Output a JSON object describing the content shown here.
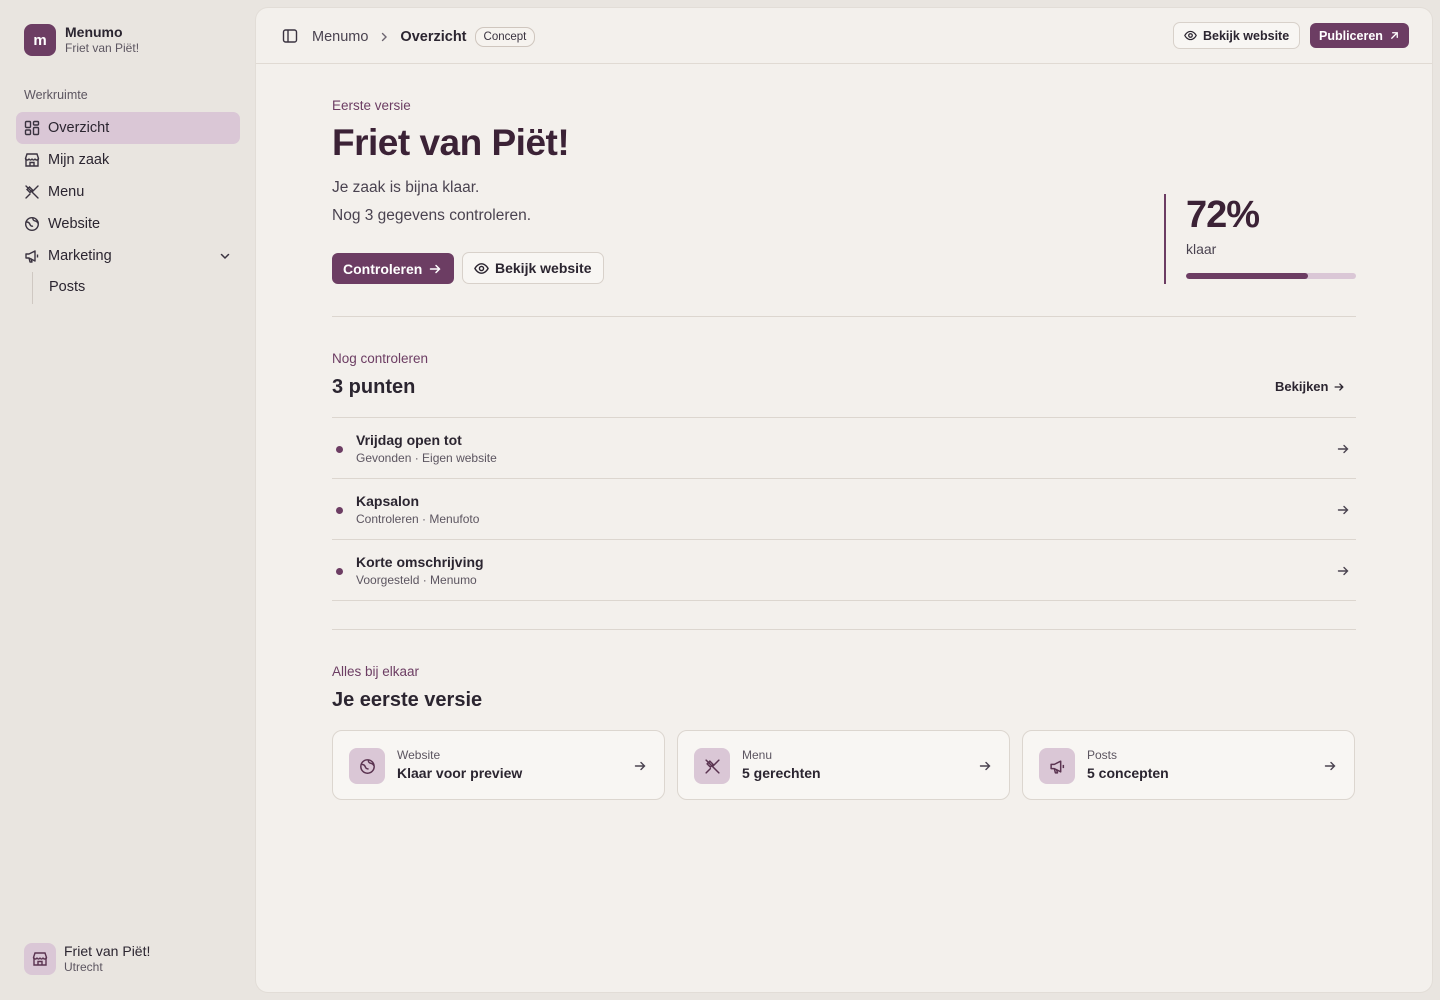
{
  "app": {
    "name": "Menumo",
    "business": "Friet van Piët!",
    "logo_letter": "m"
  },
  "sidebar": {
    "section_label": "Werkruimte",
    "items": [
      {
        "label": "Overzicht",
        "icon": "dashboard-icon",
        "active": true
      },
      {
        "label": "Mijn zaak",
        "icon": "store-icon"
      },
      {
        "label": "Menu",
        "icon": "utensils-icon"
      },
      {
        "label": "Website",
        "icon": "globe-icon"
      },
      {
        "label": "Marketing",
        "icon": "megaphone-icon",
        "expanded": true
      }
    ],
    "sub_items": [
      {
        "label": "Posts"
      }
    ],
    "account": {
      "name": "Friet van Piët!",
      "city": "Utrecht",
      "icon": "store-icon"
    }
  },
  "topbar": {
    "breadcrumb_root": "Menumo",
    "breadcrumb_current": "Overzicht",
    "status_badge": "Concept",
    "view_label": "Bekijk website",
    "publish_label": "Publiceren"
  },
  "hero": {
    "eyebrow": "Eerste versie",
    "title": "Friet van Piët!",
    "line1": "Je zaak is bijna klaar.",
    "line2": "Nog 3 gegevens controleren.",
    "primary_cta": "Controleren",
    "secondary_cta": "Bekijk website",
    "progress_text": "72%",
    "progress_label": "klaar",
    "progress_value": 0.72
  },
  "review": {
    "eyebrow": "Nog controleren",
    "title": "3 punten",
    "see_all": "Bekijken",
    "items": [
      {
        "title": "Vrijdag open tot",
        "meta": "Gevonden · Eigen website"
      },
      {
        "title": "Kapsalon",
        "meta": "Controleren · Menufoto"
      },
      {
        "title": "Korte omschrijving",
        "meta": "Voorgesteld · Menumo"
      }
    ]
  },
  "summary": {
    "eyebrow": "Alles bij elkaar",
    "title": "Je eerste versie",
    "cards": [
      {
        "kicker": "Website",
        "value": "Klaar voor preview",
        "icon": "globe-icon"
      },
      {
        "kicker": "Menu",
        "value": "5 gerechten",
        "icon": "utensils-icon"
      },
      {
        "kicker": "Posts",
        "value": "5 concepten",
        "icon": "megaphone-icon"
      }
    ]
  },
  "colors": {
    "accent": "#6c3d63",
    "accent_soft": "#dac7d6",
    "panel": "#f3f0ec",
    "sidebar_bg": "#e9e5e0"
  }
}
